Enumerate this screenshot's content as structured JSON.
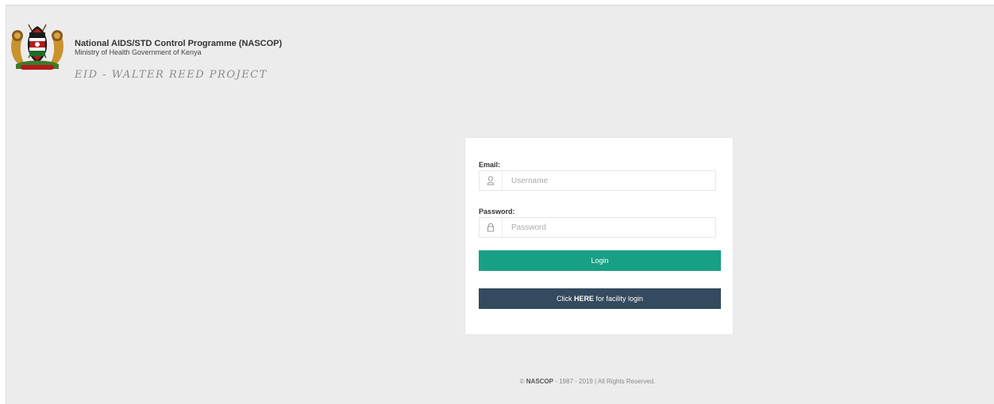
{
  "header": {
    "org_name": "National AIDS/STD Control Programme (NASCOP)",
    "ministry": "Ministry of Health Government of Kenya",
    "project": "EID - WALTER REED PROJECT"
  },
  "login": {
    "email_label": "Email:",
    "username_placeholder": "Username",
    "password_label": "Password:",
    "password_placeholder": "Password",
    "login_button": "Login",
    "facility_prefix": "Click ",
    "facility_emphasis": "HERE",
    "facility_suffix": " for facility login"
  },
  "footer": {
    "copyright_symbol": "©",
    "org": "NASCOP",
    "text": " - 1987 - 2019 | All Rights Reserved."
  },
  "icons": {
    "crest": "kenya-coat-of-arms",
    "username": "user-icon",
    "password": "lock-icon"
  },
  "colors": {
    "login_button": "#18a086",
    "facility_button": "#344a5e",
    "background": "#ececec"
  }
}
